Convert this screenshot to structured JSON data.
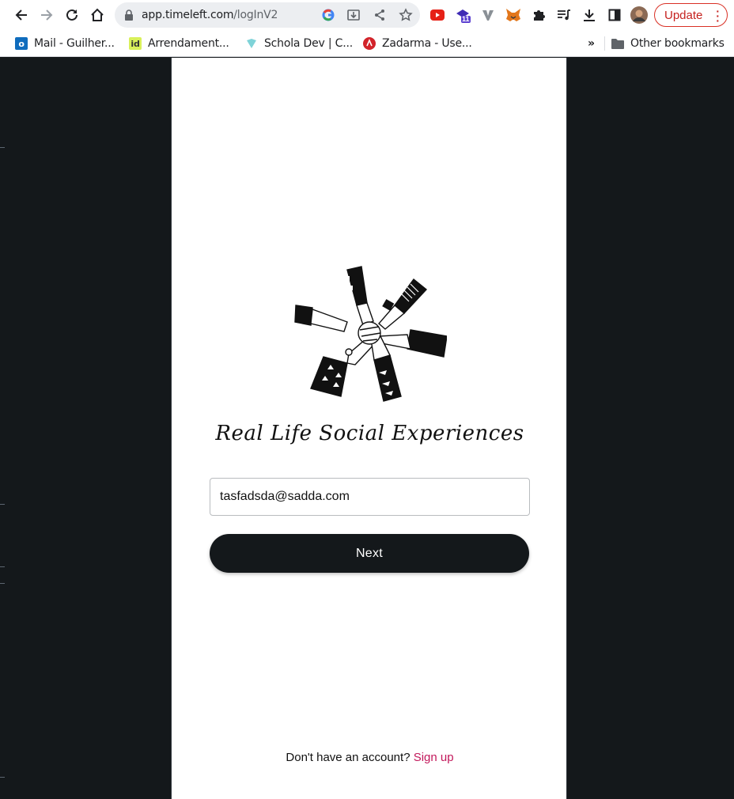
{
  "browser": {
    "url_host": "app.timeleft.com",
    "url_path": "/logInV2",
    "extension_badge": "11",
    "update_label": "Update",
    "icons": [
      "back-icon",
      "forward-icon",
      "reload-icon",
      "home-icon",
      "lock-icon",
      "google-icon",
      "install-icon",
      "share-icon",
      "star-icon",
      "extension-icon",
      "puzzle-icon",
      "media-icon",
      "download-icon",
      "sidepanel-icon",
      "avatar"
    ]
  },
  "bookmarks": {
    "items": [
      {
        "label": "Mail - Guilher...",
        "icon": "outlook-icon"
      },
      {
        "label": "Arrendament...",
        "icon": "idealista-icon"
      },
      {
        "label": "Schola Dev | C...",
        "icon": "schola-icon"
      },
      {
        "label": "Zadarma - Use...",
        "icon": "zadarma-icon"
      }
    ],
    "overflow": "»",
    "other_label": "Other bookmarks"
  },
  "login": {
    "tagline": "Real Life Social Experiences",
    "email_value": "tasfadsda@sadda.com",
    "next_label": "Next",
    "no_account_text": "Don't have an account?",
    "signup_label": "Sign up"
  },
  "colors": {
    "background": "#14181b",
    "button": "#14181b",
    "link": "#c2185b",
    "update": "#d93025"
  }
}
